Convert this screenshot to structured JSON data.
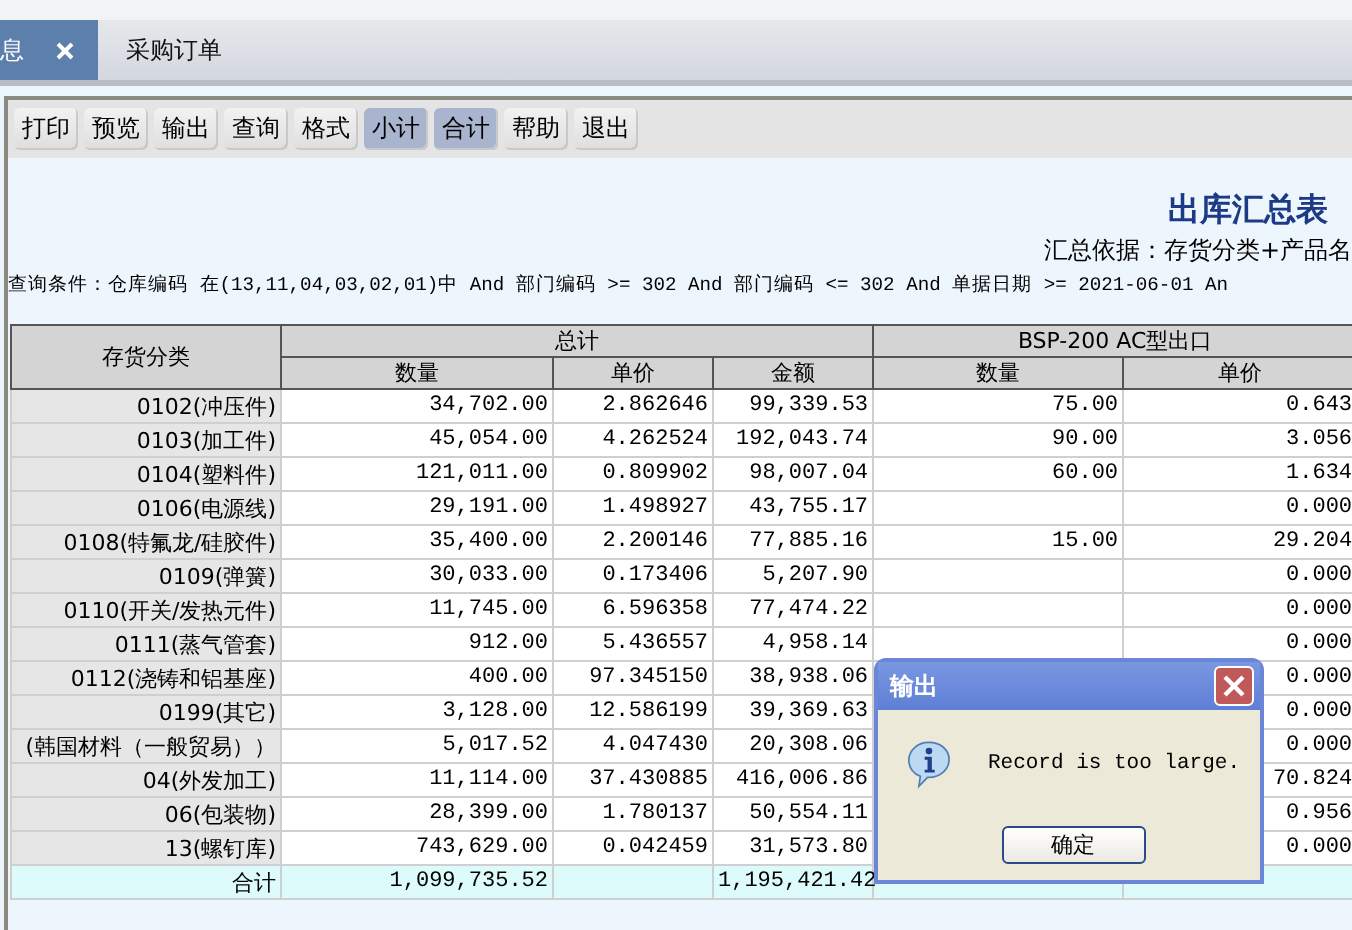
{
  "tabs": [
    {
      "label": "息",
      "selected": true
    },
    {
      "label": "采购订单",
      "selected": false
    }
  ],
  "toolbar": [
    {
      "label": "打印",
      "pressed": false
    },
    {
      "label": "预览",
      "pressed": false
    },
    {
      "label": "输出",
      "pressed": false
    },
    {
      "label": "查询",
      "pressed": false
    },
    {
      "label": "格式",
      "pressed": false
    },
    {
      "label": "小计",
      "pressed": true
    },
    {
      "label": "合计",
      "pressed": true
    },
    {
      "label": "帮助",
      "pressed": false
    },
    {
      "label": "退出",
      "pressed": false
    }
  ],
  "report": {
    "title": "出库汇总表",
    "basis": "汇总依据：存货分类+产品名",
    "query": "查询条件：仓库编码 在(13,11,04,03,02,01)中 And 部门编码 >= 302 And 部门编码 <= 302 And 单据日期 >= 2021-06-01 An"
  },
  "table": {
    "row_header": "存货分类",
    "groups": [
      {
        "label": "总计",
        "columns": [
          "数量",
          "单价",
          "金额"
        ]
      },
      {
        "label": "BSP-200 AC型出口",
        "columns": [
          "数量",
          "单价"
        ]
      }
    ],
    "rows": [
      {
        "label": "0102(冲压件)",
        "cells": [
          "34,702.00",
          "2.862646",
          "99,339.53",
          "75.00",
          "0.643"
        ]
      },
      {
        "label": "0103(加工件)",
        "cells": [
          "45,054.00",
          "4.262524",
          "192,043.74",
          "90.00",
          "3.056"
        ]
      },
      {
        "label": "0104(塑料件)",
        "cells": [
          "121,011.00",
          "0.809902",
          "98,007.04",
          "60.00",
          "1.634"
        ]
      },
      {
        "label": "0106(电源线)",
        "cells": [
          "29,191.00",
          "1.498927",
          "43,755.17",
          null,
          "0.000"
        ]
      },
      {
        "label": "0108(特氟龙/硅胶件)",
        "cells": [
          "35,400.00",
          "2.200146",
          "77,885.16",
          "15.00",
          "29.204"
        ]
      },
      {
        "label": "0109(弹簧)",
        "cells": [
          "30,033.00",
          "0.173406",
          "5,207.90",
          null,
          "0.000"
        ]
      },
      {
        "label": "0110(开关/发热元件)",
        "cells": [
          "11,745.00",
          "6.596358",
          "77,474.22",
          null,
          "0.000"
        ]
      },
      {
        "label": "0111(蒸气管套)",
        "cells": [
          "912.00",
          "5.436557",
          "4,958.14",
          null,
          "0.000"
        ]
      },
      {
        "label": "0112(浇铸和铝基座)",
        "cells": [
          "400.00",
          "97.345150",
          "38,938.06",
          null,
          "0.000"
        ]
      },
      {
        "label": "0199(其它)",
        "cells": [
          "3,128.00",
          "12.586199",
          "39,369.63",
          null,
          "0.000"
        ]
      },
      {
        "label": "(韩国材料（一般贸易））",
        "cells": [
          "5,017.52",
          "4.047430",
          "20,308.06",
          null,
          "0.000"
        ]
      },
      {
        "label": "04(外发加工)",
        "cells": [
          "11,114.00",
          "37.430885",
          "416,006.86",
          null,
          "70.824"
        ]
      },
      {
        "label": "06(包装物)",
        "cells": [
          "28,399.00",
          "1.780137",
          "50,554.11",
          null,
          "0.956"
        ]
      },
      {
        "label": "13(螺钉库)",
        "cells": [
          "743,629.00",
          "0.042459",
          "31,573.80",
          null,
          "0.000"
        ]
      }
    ],
    "total": {
      "label": "合计",
      "cells": [
        "1,099,735.52",
        null,
        "1,195,421.42",
        null,
        null
      ]
    }
  },
  "dialog": {
    "title": "输出",
    "message": "Record is too large.",
    "button": "确定"
  }
}
